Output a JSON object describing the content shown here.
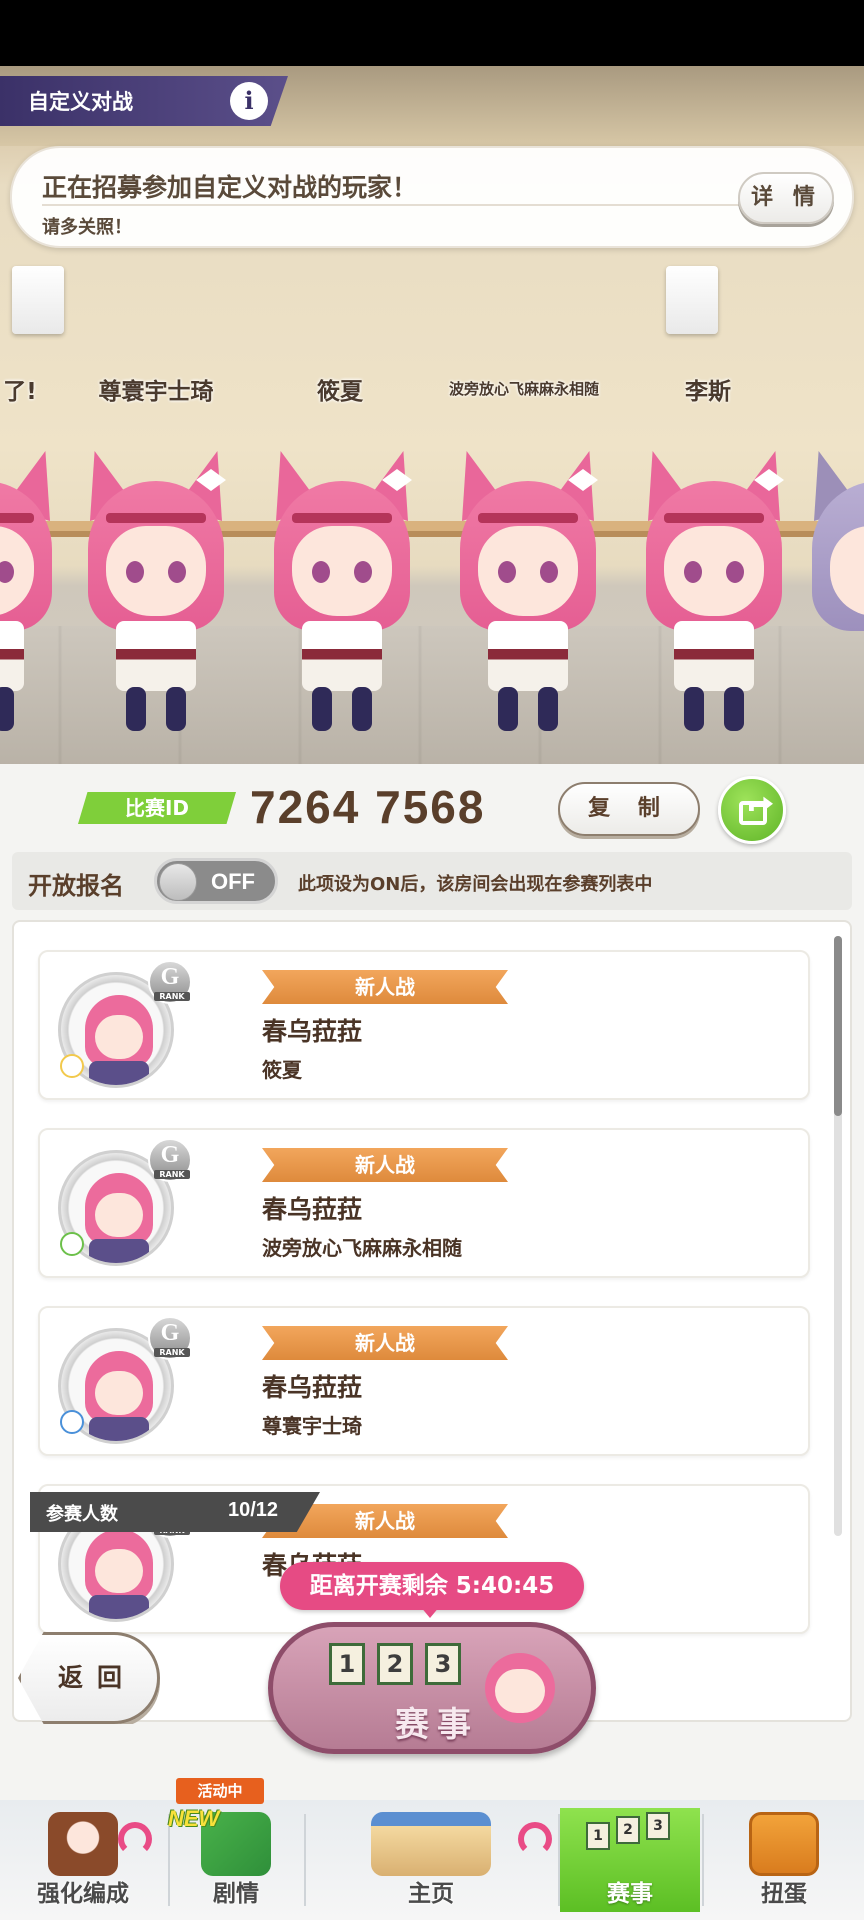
{
  "header": {
    "title": "自定义对战",
    "info_icon": "i"
  },
  "notice": {
    "main": "正在招募参加自定义对战的玩家！",
    "sub": "请多关照！",
    "detail_button": "详 情"
  },
  "players": [
    {
      "name": "了!"
    },
    {
      "name": "尊寰宇士琦"
    },
    {
      "name": "筱夏"
    },
    {
      "name": "波旁放心飞麻麻永相随"
    },
    {
      "name": "李斯"
    }
  ],
  "match": {
    "id_label": "比赛ID",
    "id_value": "7264  7568",
    "copy_button": "复 制",
    "share_icon": "share-icon"
  },
  "open_registration": {
    "label": "开放报名",
    "state": "OFF",
    "note": "此项设为ON后，该房间会出现在参赛列表中"
  },
  "entries": [
    {
      "rank": "G",
      "rank_label": "RANK",
      "race": "新人战",
      "horse": "春乌菈菈",
      "trainer": "筱夏"
    },
    {
      "rank": "G",
      "rank_label": "RANK",
      "race": "新人战",
      "horse": "春乌菈菈",
      "trainer": "波旁放心飞麻麻永相随"
    },
    {
      "rank": "G",
      "rank_label": "RANK",
      "race": "新人战",
      "horse": "春乌菈菈",
      "trainer": "尊寰宇士琦"
    },
    {
      "rank": "G",
      "rank_label": "RANK",
      "race": "新人战",
      "horse": "春乌菈菈",
      "trainer": ""
    }
  ],
  "participants": {
    "label": "参赛人数",
    "value": "10/12"
  },
  "countdown": {
    "text": "距离开赛剩余  5:40:45"
  },
  "buttons": {
    "back": "返回",
    "race": "赛事",
    "race_flags": [
      "1",
      "2",
      "3"
    ]
  },
  "nav": {
    "items": [
      {
        "label": "强化编成"
      },
      {
        "label": "剧情",
        "badge": "活动中",
        "tag": "NEW"
      },
      {
        "label": "主页"
      },
      {
        "label": "赛事",
        "flags": [
          "1",
          "2",
          "3"
        ]
      },
      {
        "label": "扭蛋"
      }
    ]
  },
  "colors": {
    "accent_green": "#7fcf3a",
    "ribbon_orange": "#de8a3c",
    "countdown_pink": "#e64b84",
    "title_purple": "#3b3168"
  }
}
